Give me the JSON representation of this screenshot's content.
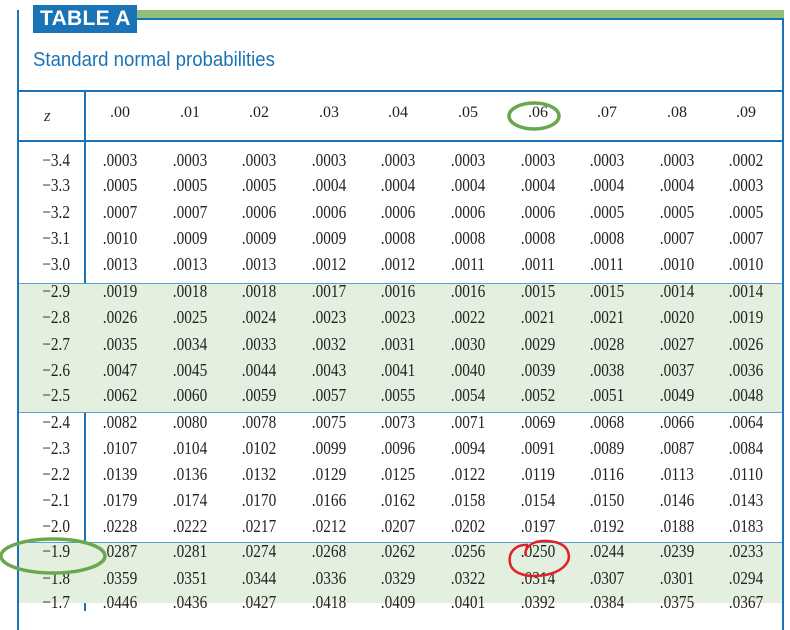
{
  "tag_label": "TABLE A",
  "subtitle": "Standard normal probabilities",
  "z_header": "z",
  "columns": [
    ".00",
    ".01",
    ".02",
    ".03",
    ".04",
    ".05",
    ".06",
    ".07",
    ".08",
    ".09"
  ],
  "rows": [
    {
      "z": "−3.4",
      "v": [
        ".0003",
        ".0003",
        ".0003",
        ".0003",
        ".0003",
        ".0003",
        ".0003",
        ".0003",
        ".0003",
        ".0002"
      ]
    },
    {
      "z": "−3.3",
      "v": [
        ".0005",
        ".0005",
        ".0005",
        ".0004",
        ".0004",
        ".0004",
        ".0004",
        ".0004",
        ".0004",
        ".0003"
      ]
    },
    {
      "z": "−3.2",
      "v": [
        ".0007",
        ".0007",
        ".0006",
        ".0006",
        ".0006",
        ".0006",
        ".0006",
        ".0005",
        ".0005",
        ".0005"
      ]
    },
    {
      "z": "−3.1",
      "v": [
        ".0010",
        ".0009",
        ".0009",
        ".0009",
        ".0008",
        ".0008",
        ".0008",
        ".0008",
        ".0007",
        ".0007"
      ]
    },
    {
      "z": "−3.0",
      "v": [
        ".0013",
        ".0013",
        ".0013",
        ".0012",
        ".0012",
        ".0011",
        ".0011",
        ".0011",
        ".0010",
        ".0010"
      ]
    },
    {
      "z": "−2.9",
      "v": [
        ".0019",
        ".0018",
        ".0018",
        ".0017",
        ".0016",
        ".0016",
        ".0015",
        ".0015",
        ".0014",
        ".0014"
      ]
    },
    {
      "z": "−2.8",
      "v": [
        ".0026",
        ".0025",
        ".0024",
        ".0023",
        ".0023",
        ".0022",
        ".0021",
        ".0021",
        ".0020",
        ".0019"
      ]
    },
    {
      "z": "−2.7",
      "v": [
        ".0035",
        ".0034",
        ".0033",
        ".0032",
        ".0031",
        ".0030",
        ".0029",
        ".0028",
        ".0027",
        ".0026"
      ]
    },
    {
      "z": "−2.6",
      "v": [
        ".0047",
        ".0045",
        ".0044",
        ".0043",
        ".0041",
        ".0040",
        ".0039",
        ".0038",
        ".0037",
        ".0036"
      ]
    },
    {
      "z": "−2.5",
      "v": [
        ".0062",
        ".0060",
        ".0059",
        ".0057",
        ".0055",
        ".0054",
        ".0052",
        ".0051",
        ".0049",
        ".0048"
      ]
    },
    {
      "z": "−2.4",
      "v": [
        ".0082",
        ".0080",
        ".0078",
        ".0075",
        ".0073",
        ".0071",
        ".0069",
        ".0068",
        ".0066",
        ".0064"
      ]
    },
    {
      "z": "−2.3",
      "v": [
        ".0107",
        ".0104",
        ".0102",
        ".0099",
        ".0096",
        ".0094",
        ".0091",
        ".0089",
        ".0087",
        ".0084"
      ]
    },
    {
      "z": "−2.2",
      "v": [
        ".0139",
        ".0136",
        ".0132",
        ".0129",
        ".0125",
        ".0122",
        ".0119",
        ".0116",
        ".0113",
        ".0110"
      ]
    },
    {
      "z": "−2.1",
      "v": [
        ".0179",
        ".0174",
        ".0170",
        ".0166",
        ".0162",
        ".0158",
        ".0154",
        ".0150",
        ".0146",
        ".0143"
      ]
    },
    {
      "z": "−2.0",
      "v": [
        ".0228",
        ".0222",
        ".0217",
        ".0212",
        ".0207",
        ".0202",
        ".0197",
        ".0192",
        ".0188",
        ".0183"
      ]
    },
    {
      "z": "−1.9",
      "v": [
        ".0287",
        ".0281",
        ".0274",
        ".0268",
        ".0262",
        ".0256",
        ".0250",
        ".0244",
        ".0239",
        ".0233"
      ]
    },
    {
      "z": "−1.8",
      "v": [
        ".0359",
        ".0351",
        ".0344",
        ".0336",
        ".0329",
        ".0322",
        ".0314",
        ".0307",
        ".0301",
        ".0294"
      ]
    },
    {
      "z": "−1.7",
      "v": [
        ".0446",
        ".0436",
        ".0427",
        ".0418",
        ".0409",
        ".0401",
        ".0392",
        ".0384",
        ".0375",
        ".0367"
      ]
    }
  ],
  "annotation_colors": {
    "green": "#6aa84f",
    "red": "#e0202a"
  },
  "band_color": "#e4f0df",
  "accent_color": "#1a73b7"
}
